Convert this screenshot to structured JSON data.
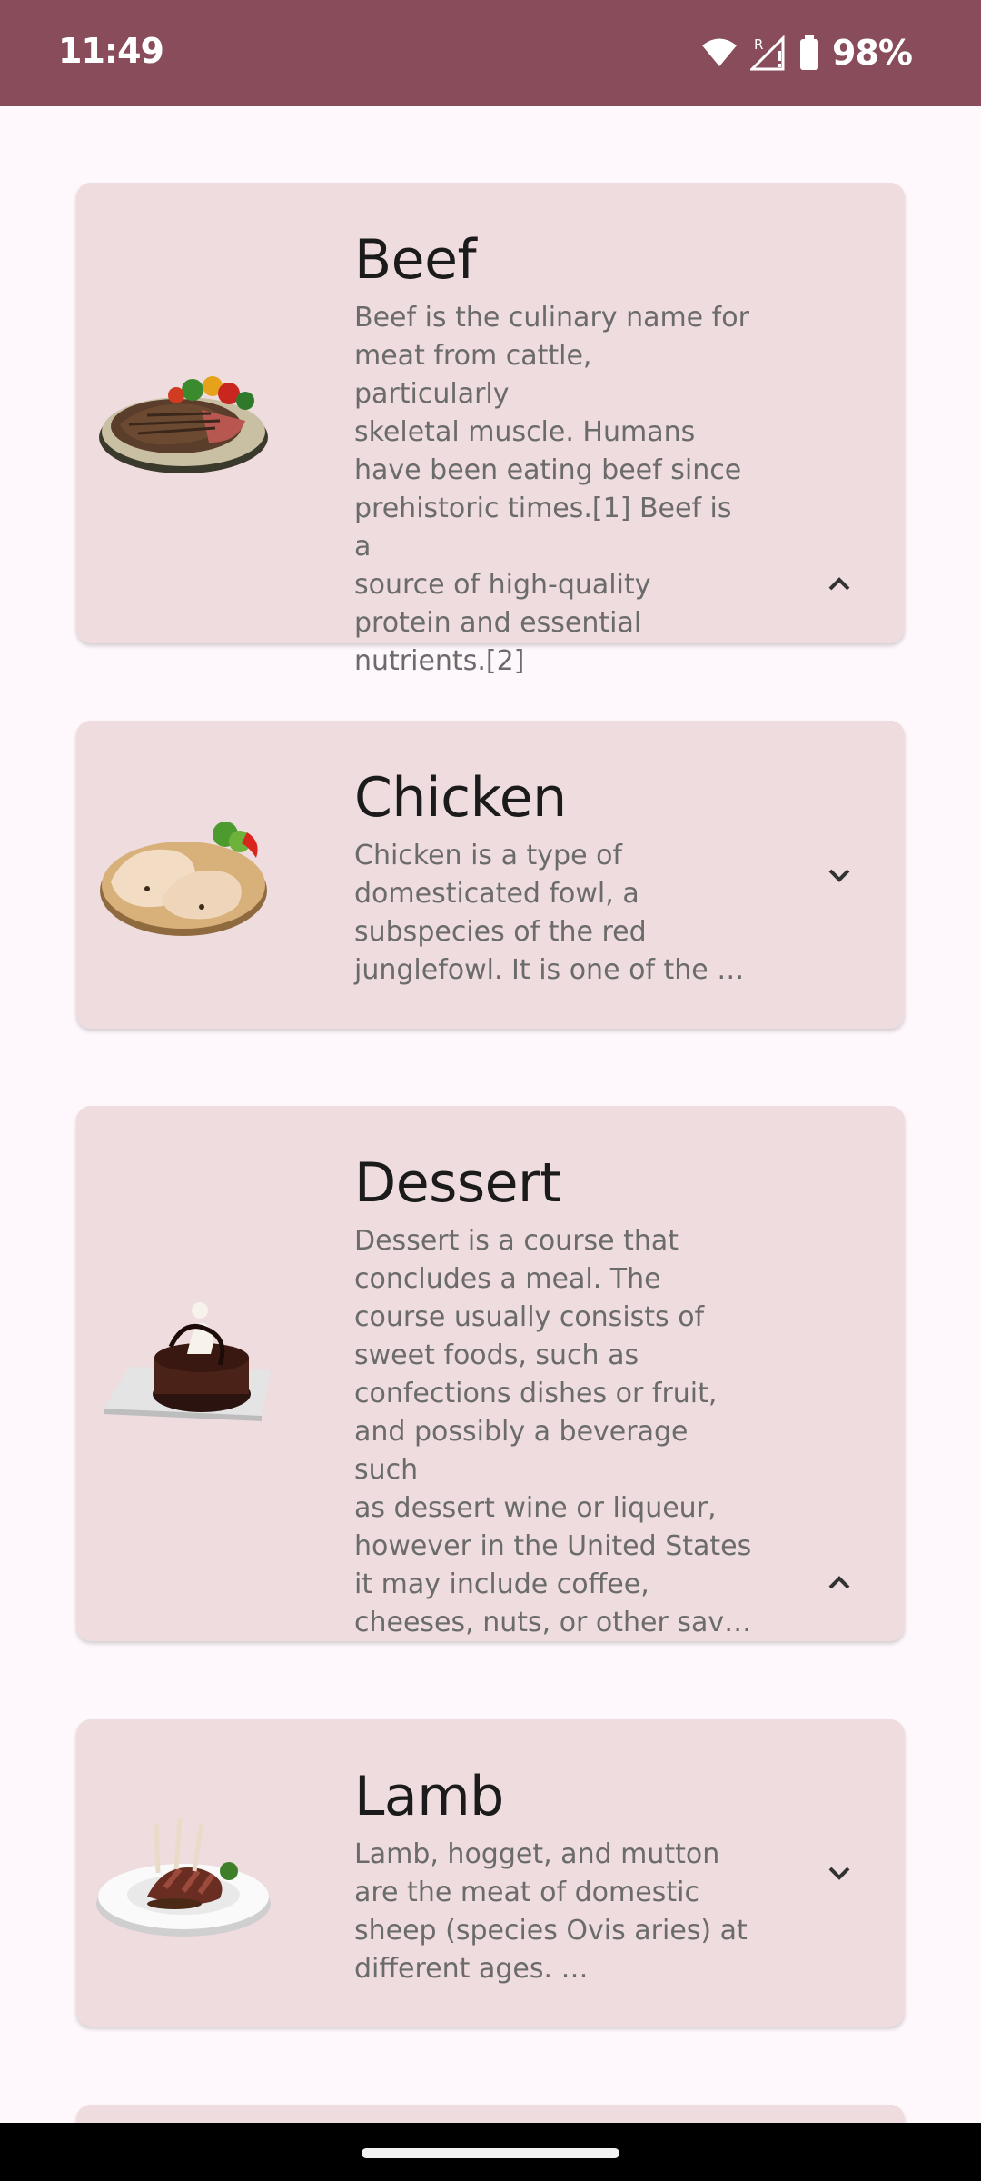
{
  "status_bar": {
    "time": "11:49",
    "battery_percent": "98%",
    "signal_badge": "R"
  },
  "cards": [
    {
      "title": "Beef",
      "description": "Beef is the culinary name for\nmeat from cattle, particularly\nskeletal muscle. Humans\nhave been eating beef since\nprehistoric times.[1] Beef is a\nsource of high-quality\nprotein and essential\nnutrients.[2]",
      "expanded": true,
      "image_icon": "beef-steak-plate"
    },
    {
      "title": "Chicken",
      "description": "Chicken is a type of\ndomesticated fowl, a\nsubspecies of the red\njunglefowl. It is one of the …",
      "expanded": false,
      "image_icon": "chicken-legs-board"
    },
    {
      "title": "Dessert",
      "description": "Dessert is a course that\nconcludes a meal. The\ncourse usually consists of\nsweet foods, such as\nconfections dishes or fruit,\nand possibly a beverage such\nas dessert wine or liqueur,\nhowever in the United States\nit may include coffee,\ncheeses, nuts, or other sav…",
      "expanded": true,
      "image_icon": "chocolate-cake-plate"
    },
    {
      "title": "Lamb",
      "description": "Lamb, hogget, and mutton\nare the meat of domestic\nsheep (species Ovis aries) at\ndifferent ages. …",
      "expanded": false,
      "image_icon": "lamb-chops-plate"
    }
  ],
  "colors": {
    "status_bar": "#884c5a",
    "background": "#fef7fb",
    "card": "#eedcdf"
  }
}
